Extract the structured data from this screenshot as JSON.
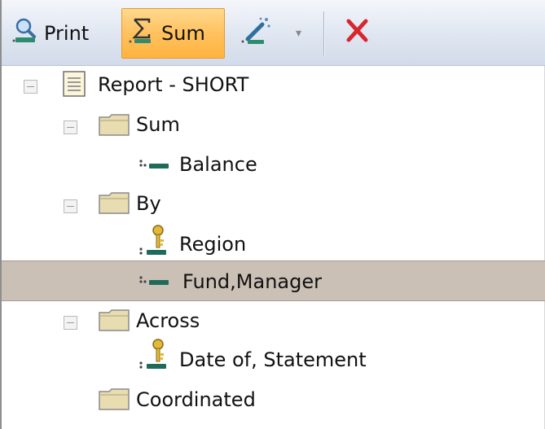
{
  "toolbar": {
    "print_label": "Print",
    "sum_label": "Sum",
    "icons": {
      "print": "print-icon",
      "sum": "sigma-sum-icon",
      "wand": "magic-wand-icon",
      "dropdown": "chevron-down-icon",
      "delete": "red-x-icon"
    },
    "active_color": "#ffc15e"
  },
  "tree": {
    "root": {
      "label": "Report - SHORT",
      "icon": "report-document-icon"
    },
    "sum": {
      "label": "Sum",
      "icon": "folder-icon",
      "children": [
        {
          "label": "Balance",
          "icon": "field-icon"
        }
      ]
    },
    "by": {
      "label": "By",
      "icon": "folder-icon",
      "children": [
        {
          "label": "Region",
          "icon": "key-field-icon"
        },
        {
          "label": "Fund,Manager",
          "icon": "field-icon",
          "selected": true
        }
      ]
    },
    "across": {
      "label": "Across",
      "icon": "folder-icon",
      "children": [
        {
          "label": "Date of, Statement",
          "icon": "key-field-icon"
        }
      ]
    },
    "coordinated": {
      "label": "Coordinated",
      "icon": "folder-icon"
    }
  },
  "colors": {
    "selection": "#cbc0b6",
    "delete": "#d8262e"
  }
}
